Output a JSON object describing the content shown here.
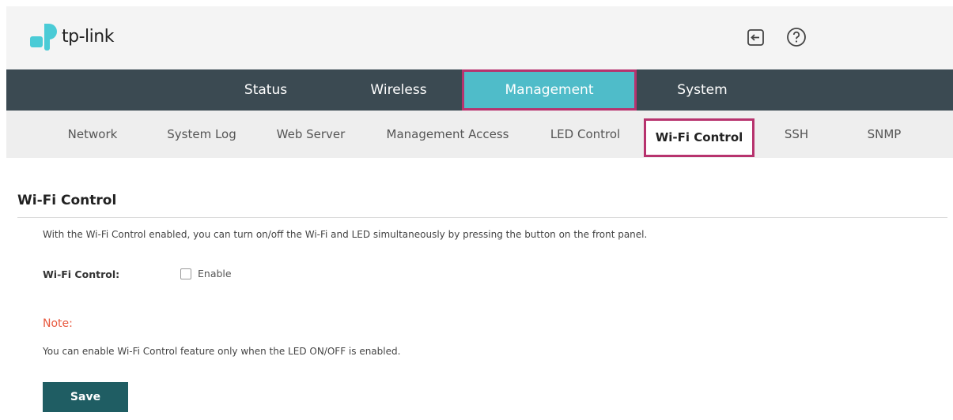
{
  "brand": {
    "name": "tp-link",
    "logo_color": "#4acbd6"
  },
  "header_icons": [
    "logout-icon",
    "help-icon"
  ],
  "main_nav": {
    "tabs": [
      {
        "label": "Status",
        "active": false
      },
      {
        "label": "Wireless",
        "active": false
      },
      {
        "label": "Management",
        "active": true
      },
      {
        "label": "System",
        "active": false
      }
    ]
  },
  "sub_nav": {
    "items": [
      {
        "label": "Network",
        "active": false
      },
      {
        "label": "System Log",
        "active": false
      },
      {
        "label": "Web Server",
        "active": false
      },
      {
        "label": "Management Access",
        "active": false
      },
      {
        "label": "LED Control",
        "active": false
      },
      {
        "label": "Wi-Fi Control",
        "active": true
      },
      {
        "label": "SSH",
        "active": false
      },
      {
        "label": "SNMP",
        "active": false
      }
    ]
  },
  "content": {
    "title": "Wi-Fi Control",
    "description": "With the Wi-Fi Control enabled, you can turn on/off the Wi-Fi and LED simultaneously by pressing the button on the front panel.",
    "field_label": "Wi-Fi Control:",
    "checkbox_label": "Enable",
    "checkbox_checked": false,
    "note_title": "Note:",
    "note_text": "You can enable Wi-Fi Control feature only when the LED ON/OFF is enabled.",
    "save_label": "Save"
  },
  "colors": {
    "nav_bg": "#3b4a52",
    "active_tab_bg": "#4fbcc9",
    "highlight_border": "#b7336e",
    "note_color": "#e8593f",
    "button_bg": "#1f5d63"
  }
}
